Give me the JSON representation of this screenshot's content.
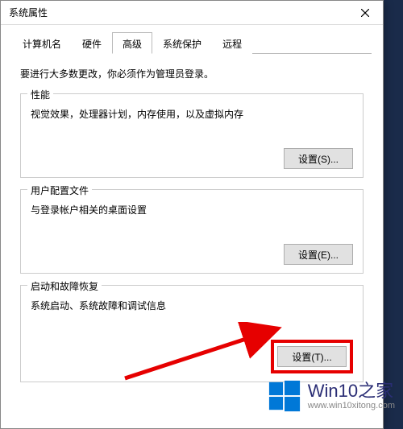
{
  "dialog": {
    "title": "系统属性"
  },
  "tabs": {
    "items": [
      {
        "label": "计算机名"
      },
      {
        "label": "硬件"
      },
      {
        "label": "高级"
      },
      {
        "label": "系统保护"
      },
      {
        "label": "远程"
      }
    ],
    "activeIndex": 2
  },
  "panel": {
    "intro": "要进行大多数更改，你必须作为管理员登录。",
    "groups": [
      {
        "title": "性能",
        "desc": "视觉效果，处理器计划，内存使用，以及虚拟内存",
        "button": "设置(S)..."
      },
      {
        "title": "用户配置文件",
        "desc": "与登录帐户相关的桌面设置",
        "button": "设置(E)..."
      },
      {
        "title": "启动和故障恢复",
        "desc": "系统启动、系统故障和调试信息",
        "button": "设置(T)..."
      }
    ]
  },
  "watermark": {
    "brand": "Win10之家",
    "url": "www.win10xitong.com"
  },
  "colors": {
    "accent": "#0078d7",
    "highlight": "#e60000"
  }
}
